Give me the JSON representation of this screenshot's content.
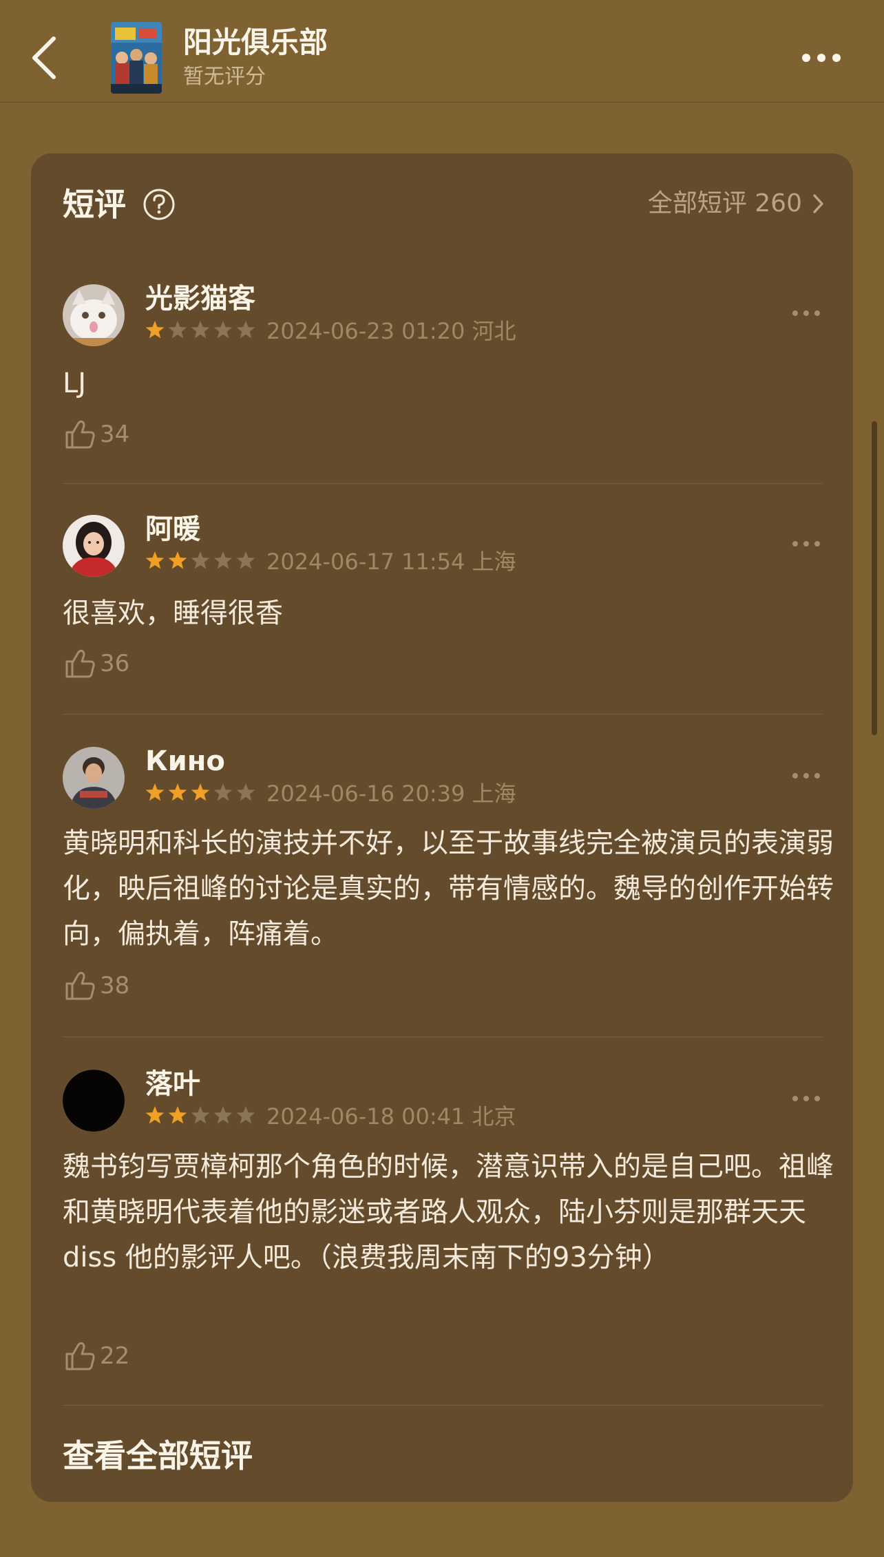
{
  "header": {
    "title": "阳光俱乐部",
    "rating": "暂无评分"
  },
  "section": {
    "title": "短评",
    "all_label": "全部短评 260",
    "footer": "查看全部短评"
  },
  "colors": {
    "star_filled": "#f0a025",
    "star_empty": "#8a7656",
    "card_bg": "#644b2c",
    "page_bg": "#7f6232"
  },
  "reviews": [
    {
      "user": "光影猫客",
      "rating": 1,
      "time": "2024-06-23 01:20",
      "location": "河北",
      "text": "LJ",
      "likes": "34",
      "avatar": "cat-photo"
    },
    {
      "user": "阿暖",
      "rating": 2,
      "time": "2024-06-17 11:54",
      "location": "上海",
      "text": "很喜欢，睡得很香",
      "likes": "36",
      "avatar": "person-photo"
    },
    {
      "user": "Кино",
      "rating": 3,
      "time": "2024-06-16 20:39",
      "location": "上海",
      "text": "黄晓明和科长的演技并不好，以至于故事线完全被演员的表演弱化，映后祖峰的讨论是真实的，带有情感的。魏导的创作开始转向，偏执着，阵痛着。",
      "likes": "38",
      "avatar": "person-photo"
    },
    {
      "user": "落叶",
      "rating": 2,
      "time": "2024-06-18 00:41",
      "location": "北京",
      "text": "魏书钧写贾樟柯那个角色的时候，潜意识带入的是自己吧。祖峰和黄晓明代表着他的影迷或者路人观众，陆小芬则是那群天天 diss 他的影评人吧。（浪费我周末南下的93分钟）",
      "likes": "22",
      "avatar": "black-circle"
    }
  ]
}
